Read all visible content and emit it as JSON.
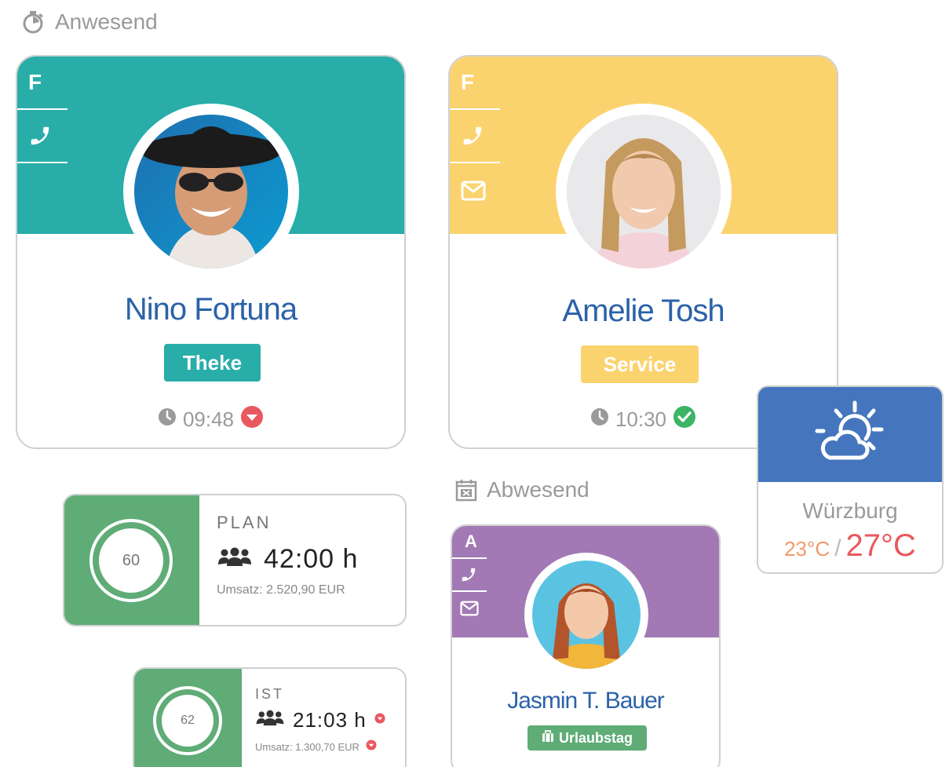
{
  "present": {
    "label": "Anwesend"
  },
  "absent": {
    "label": "Abwesend"
  },
  "employees": [
    {
      "initial": "F",
      "name": "Nino Fortuna",
      "role": "Theke",
      "time": "09:48",
      "status": "late",
      "color": "#28ada9",
      "tag_color": "#28ada9"
    },
    {
      "initial": "F",
      "name": "Amelie Tosh",
      "role": "Service",
      "time": "10:30",
      "status": "ok",
      "color": "#fbd36e",
      "tag_color": "#fbd36e"
    }
  ],
  "absent_employee": {
    "initial": "A",
    "name": "Jasmin T. Bauer",
    "reason": "Urlaubstag",
    "color": "#a279b4",
    "tag_color": "#5fac76"
  },
  "plan": {
    "label": "PLAN",
    "ring_value": "60",
    "hours": "42:00 h",
    "revenue": "Umsatz: 2.520,90 EUR"
  },
  "actual": {
    "label": "IST",
    "ring_value": "62",
    "hours": "21:03 h",
    "revenue": "Umsatz: 1.300,70 EUR"
  },
  "weather": {
    "city": "Würzburg",
    "low": "23°C",
    "separator": "/",
    "high": "27°C",
    "icon": "partly-cloudy-icon",
    "header_color": "#4576bd"
  },
  "colors": {
    "name_blue": "#2b62a8",
    "alert_red": "#e8595f",
    "ok_green": "#3bb463",
    "stat_green": "#5fac76"
  }
}
